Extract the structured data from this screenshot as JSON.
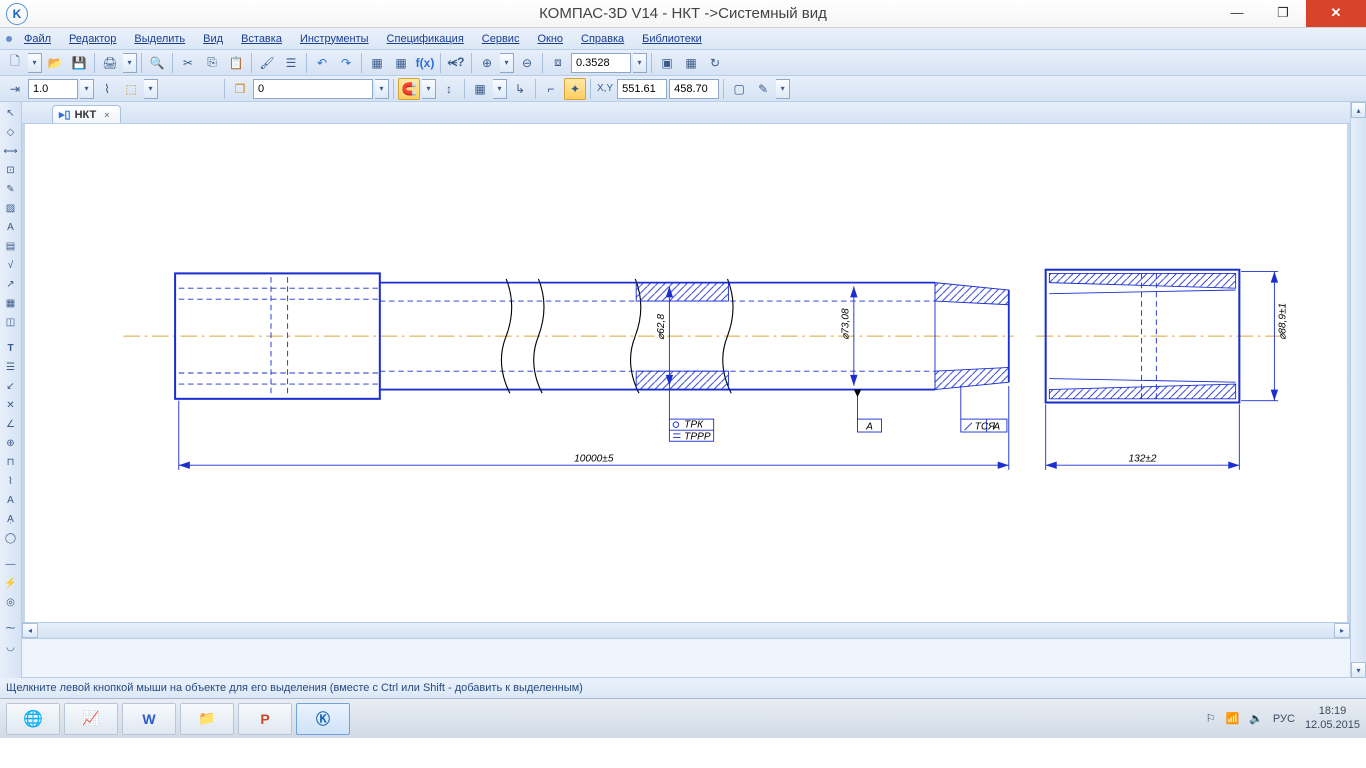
{
  "title": "КОМПАС-3D V14 - НКТ ->Системный вид",
  "menu": [
    "Файл",
    "Редактор",
    "Выделить",
    "Вид",
    "Вставка",
    "Инструменты",
    "Спецификация",
    "Сервис",
    "Окно",
    "Справка",
    "Библиотеки"
  ],
  "tb1": {
    "zoom": "0.3528"
  },
  "tb2": {
    "step": "1.0",
    "layer": "0",
    "coord_x": "551.61",
    "coord_y": "458.70"
  },
  "tab": {
    "name": "НКТ"
  },
  "drawing": {
    "dim_length": "10000±5",
    "dim_coupling": "132±2",
    "dim_d1": "⌀62,8",
    "dim_d2": "⌀73,08",
    "dim_d3": "⌀88,9±1",
    "label_a": "А",
    "note1a": "ТРК",
    "note1b": "ТРРР",
    "note2": "ТСЯ"
  },
  "status": "Щелкните левой кнопкой мыши на объекте для его выделения (вместе с Ctrl или Shift - добавить к выделенным)",
  "tray": {
    "lang": "РУС",
    "time": "18:19",
    "date": "12.05.2015"
  }
}
